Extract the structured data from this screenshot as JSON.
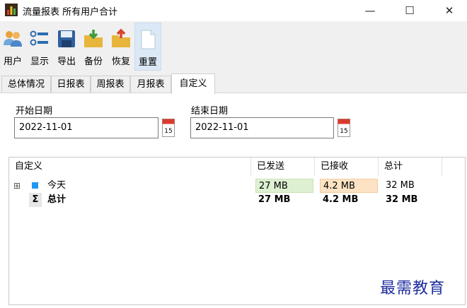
{
  "window": {
    "title": "流量报表 所有用户合计",
    "minimize_glyph": "—",
    "maximize_glyph": "☐",
    "close_glyph": "✕"
  },
  "toolbar": {
    "items": [
      {
        "label": "用户",
        "icon": "users-icon"
      },
      {
        "label": "显示",
        "icon": "list-icon"
      },
      {
        "label": "导出",
        "icon": "save-icon"
      },
      {
        "label": "备份",
        "icon": "folder-download-icon"
      },
      {
        "label": "恢复",
        "icon": "folder-upload-icon"
      },
      {
        "label": "重置",
        "icon": "blank-page-icon"
      }
    ],
    "active_item": "重置"
  },
  "tabs": [
    {
      "label": "总体情况"
    },
    {
      "label": "日报表"
    },
    {
      "label": "周报表"
    },
    {
      "label": "月报表"
    },
    {
      "label": "自定义"
    }
  ],
  "selected_tab": "自定义",
  "form": {
    "start_label": "开始日期",
    "start_value": "2022-11-01",
    "end_label": "结束日期",
    "end_value": "2022-11-01",
    "calendar_day": "15"
  },
  "table": {
    "columns": [
      "自定义",
      "已发送",
      "已接收",
      "总计"
    ],
    "rows": [
      {
        "expander": "⊞",
        "name": "今天",
        "sent": "27 MB",
        "received": "4.2 MB",
        "total": "32 MB"
      },
      {
        "sigma": "Σ",
        "name": "总计",
        "sent": "27 MB",
        "received": "4.2 MB",
        "total": "32 MB"
      }
    ]
  },
  "colors": {
    "sent_highlight": "#def0d2",
    "received_highlight": "#fde3c3",
    "row_marker": "#2196f3"
  },
  "watermark": "最需教育"
}
